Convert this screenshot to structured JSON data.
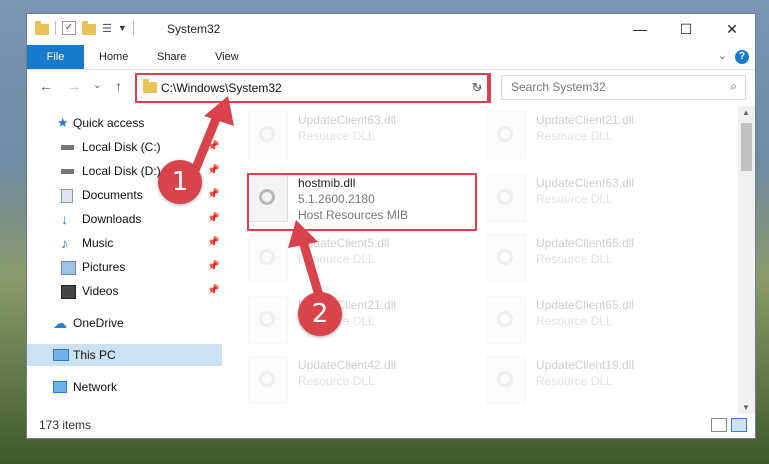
{
  "window": {
    "title": "System32",
    "controls": {
      "minimize": "—",
      "maximize": "☐",
      "close": "✕"
    }
  },
  "ribbon": {
    "tabs": [
      "File",
      "Home",
      "Share",
      "View"
    ],
    "help": "?",
    "collapse_chevron": "⌄"
  },
  "nav": {
    "back": "←",
    "forward": "→",
    "recent": "⌄",
    "up": "↑",
    "address": "C:\\Windows\\System32",
    "address_dropdown": "⌄",
    "refresh": "↻",
    "search_placeholder": "Search System32",
    "search_icon": "⌕"
  },
  "sidebar": {
    "items": [
      {
        "label": "Quick access",
        "icon": "star-icon",
        "pinned": false
      },
      {
        "label": "Local Disk (C:)",
        "icon": "drive-icon",
        "pinned": true
      },
      {
        "label": "Local Disk (D:)",
        "icon": "drive-icon",
        "pinned": true
      },
      {
        "label": "Documents",
        "icon": "documents-icon",
        "pinned": true
      },
      {
        "label": "Downloads",
        "icon": "download-icon",
        "pinned": true
      },
      {
        "label": "Music",
        "icon": "music-icon",
        "pinned": true
      },
      {
        "label": "Pictures",
        "icon": "pictures-icon",
        "pinned": true
      },
      {
        "label": "Videos",
        "icon": "videos-icon",
        "pinned": true
      },
      {
        "label": "OneDrive",
        "icon": "cloud-icon",
        "pinned": false
      },
      {
        "label": "This PC",
        "icon": "computer-icon",
        "pinned": false,
        "selected": true
      },
      {
        "label": "Network",
        "icon": "network-icon",
        "pinned": false
      }
    ],
    "pin_glyph": "📌"
  },
  "files": {
    "left": [
      {
        "name": "UpdateClient63.dll",
        "type": "Resource DLL"
      },
      {
        "name": "hostmib.dll",
        "version": "5.1.2600.2180",
        "description": "Host Resources MIB"
      },
      {
        "name": "UpdateClient5.dll",
        "type": "Resource DLL"
      },
      {
        "name": "UpdateClient21.dll",
        "type": "Resource DLL"
      },
      {
        "name": "UpdateClient42.dll",
        "type": "Resource DLL"
      }
    ],
    "right": [
      {
        "name": "UpdateClient21.dll",
        "type": "Resource DLL"
      },
      {
        "name": "UpdateClient63.dll",
        "type": "Resource DLL"
      },
      {
        "name": "UpdateClient65.dll",
        "type": "Resource DLL"
      },
      {
        "name": "UpdateClient65.dll",
        "type": "Resource DLL"
      },
      {
        "name": "UpdateClient19.dll",
        "type": "Resource DLL"
      }
    ]
  },
  "status": {
    "item_count": "173 items"
  },
  "annotations": {
    "step1": "1",
    "step2": "2",
    "color": "#d9434b"
  }
}
